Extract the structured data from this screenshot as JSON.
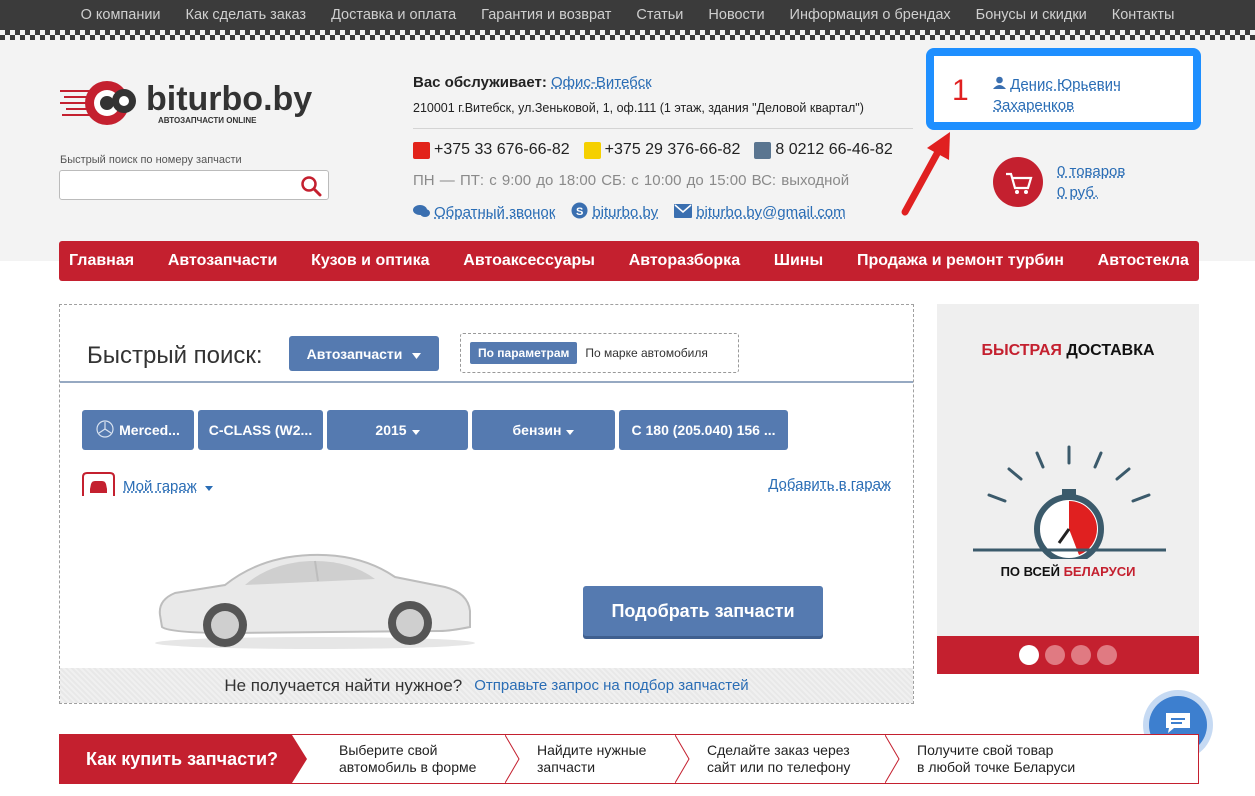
{
  "top_nav": [
    "О компании",
    "Как сделать заказ",
    "Доставка и оплата",
    "Гарантия и возврат",
    "Статьи",
    "Новости",
    "Информация о брендах",
    "Бонусы и скидки",
    "Контакты"
  ],
  "logo": {
    "brand": "biturbo.by",
    "tagline": "АВТОЗАПЧАСТИ ONLINE"
  },
  "quick_search": {
    "label": "Быстрый поиск по номеру запчасти",
    "value": "",
    "placeholder": ""
  },
  "service": {
    "label": "Вас обслуживает:",
    "office": "Офис-Витебск",
    "address": "210001 г.Витебск, ул.Зеньковой, 1, оф.111 (1 этаж, здания \"Деловой квартал\")"
  },
  "phones": [
    "+375 33 676-66-82",
    "+375 29 376-66-82",
    "8 0212 66-46-82"
  ],
  "hours": "ПН — ПТ: с 9:00 до 18:00   СБ: с 10:00 до 15:00   ВС: выходной",
  "contacts": {
    "callback": "Обратный звонок",
    "skype": "biturbo.by",
    "email": "biturbo.by@gmail.com"
  },
  "user": {
    "number": "1",
    "name": "Денис Юрьевич Захаренков"
  },
  "cart": {
    "items": "0 товаров",
    "total": "0 руб."
  },
  "main_nav": [
    "Главная",
    "Автозапчасти",
    "Кузов и оптика",
    "Автоаксессуары",
    "Авторазборка",
    "Шины",
    "Продажа и ремонт турбин",
    "Автостекла"
  ],
  "search_panel": {
    "title": "Быстрый поиск:",
    "category": "Автозапчасти",
    "tab_active": "По параметрам",
    "tab_other": "По марке автомобиля",
    "selectors": {
      "brand": "Merced...",
      "model": "C-CLASS (W2...",
      "year": "2015",
      "fuel": "бензин",
      "modification": "C 180 (205.040) 156 ..."
    },
    "my_garage": "Мой гараж",
    "add_garage": "Добавить в гараж",
    "pick_button": "Подобрать запчасти",
    "footer_text": "Не получается найти нужное?",
    "footer_link": "Отправьте запрос на подбор запчастей"
  },
  "banner": {
    "title_red": "БЫСТРАЯ",
    "title_black": "ДОСТАВКА",
    "sub_black": "ПО ВСЕЙ",
    "sub_red": "БЕЛАРУСИ",
    "slides": 4,
    "active_slide": 1
  },
  "howto": {
    "title": "Как купить запчасти?",
    "steps": [
      [
        "Выберите свой",
        "автомобиль в форме"
      ],
      [
        "Найдите нужные",
        "запчасти"
      ],
      [
        "Сделайте заказ через",
        "сайт или по телефону"
      ],
      [
        "Получите свой товар",
        "в любой точке Беларуси"
      ]
    ]
  },
  "colors": {
    "brand_red": "#c4202f",
    "button_blue": "#557ab0",
    "link_blue": "#2a6db5",
    "highlight_blue": "#1e8fff"
  }
}
